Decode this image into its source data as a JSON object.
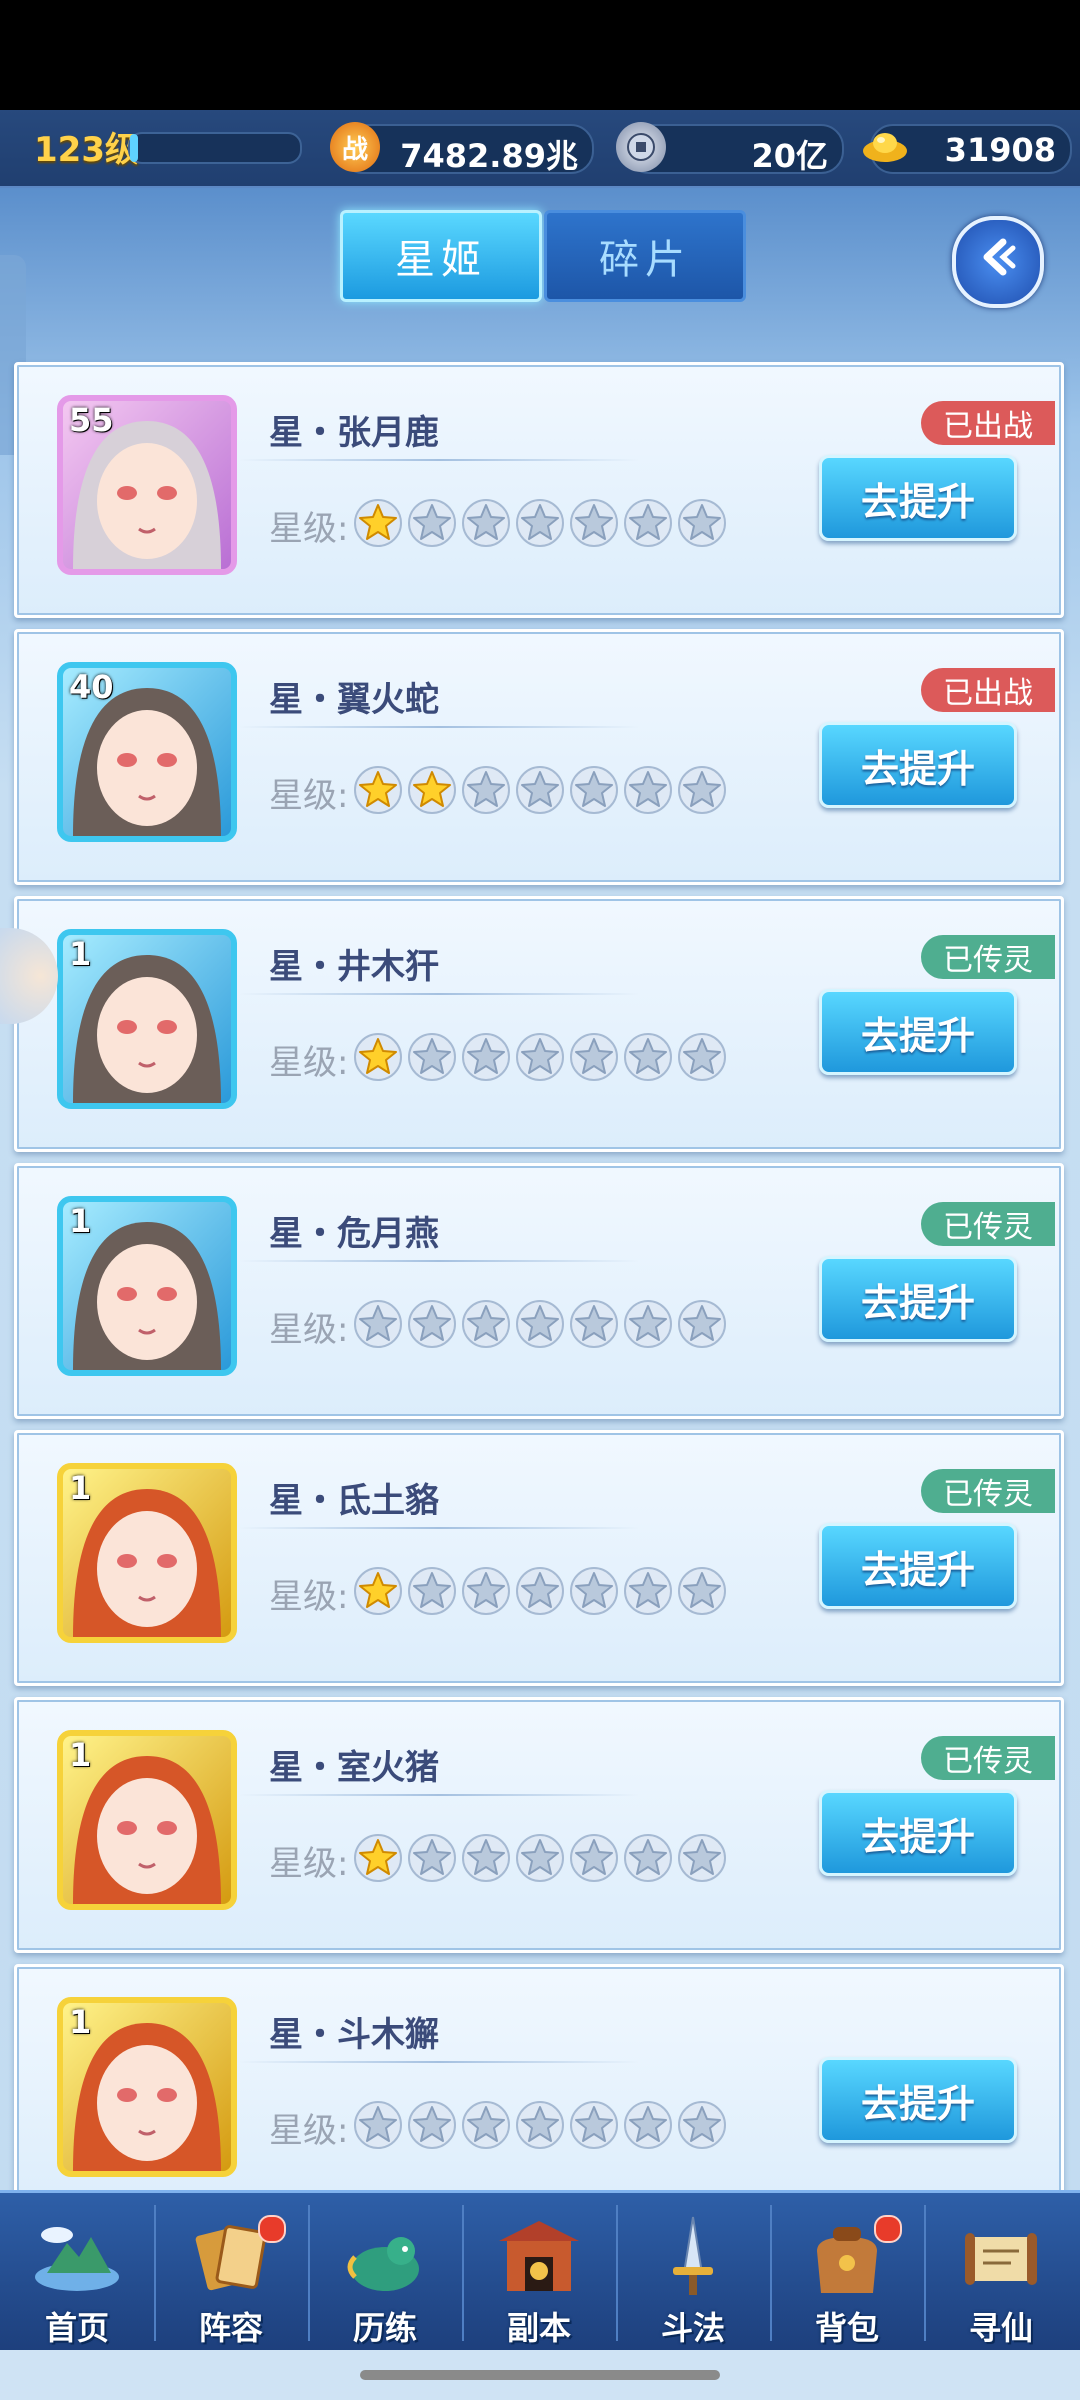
{
  "topbar": {
    "level": "123级",
    "power_icon_text": "战",
    "power": "7482.89兆",
    "coin": "20亿",
    "gold": "31908"
  },
  "tabs": [
    {
      "label": "星姬",
      "active": true
    },
    {
      "label": "碎片",
      "active": false
    }
  ],
  "star_label": "星级:",
  "upgrade_label": "去提升",
  "cards": [
    {
      "level": "55",
      "name": "星・张月鹿",
      "stars": 1,
      "status": "已出战",
      "status_color": "#dc5a5a",
      "rarity": "purple"
    },
    {
      "level": "40",
      "name": "星・翼火蛇",
      "stars": 2,
      "status": "已出战",
      "status_color": "#dc5a5a",
      "rarity": "blue"
    },
    {
      "level": "1",
      "name": "星・井木犴",
      "stars": 1,
      "status": "已传灵",
      "status_color": "#4fae90",
      "rarity": "blue"
    },
    {
      "level": "1",
      "name": "星・危月燕",
      "stars": 0,
      "status": "已传灵",
      "status_color": "#4fae90",
      "rarity": "blue"
    },
    {
      "level": "1",
      "name": "星・氐土貉",
      "stars": 1,
      "status": "已传灵",
      "status_color": "#4fae90",
      "rarity": "gold"
    },
    {
      "level": "1",
      "name": "星・室火猪",
      "stars": 1,
      "status": "已传灵",
      "status_color": "#4fae90",
      "rarity": "gold"
    },
    {
      "level": "1",
      "name": "星・斗木獬",
      "stars": 0,
      "status": "",
      "status_color": "",
      "rarity": "gold"
    }
  ],
  "max_stars": 7,
  "bottom_nav": [
    {
      "label": "首页",
      "icon": "island-icon",
      "dot": false
    },
    {
      "label": "阵容",
      "icon": "cards-icon",
      "dot": true
    },
    {
      "label": "历练",
      "icon": "dragon-icon",
      "dot": false
    },
    {
      "label": "副本",
      "icon": "gate-icon",
      "dot": false
    },
    {
      "label": "斗法",
      "icon": "sword-icon",
      "dot": false
    },
    {
      "label": "背包",
      "icon": "bag-icon",
      "dot": true
    },
    {
      "label": "寻仙",
      "icon": "scroll-icon",
      "dot": false
    }
  ]
}
